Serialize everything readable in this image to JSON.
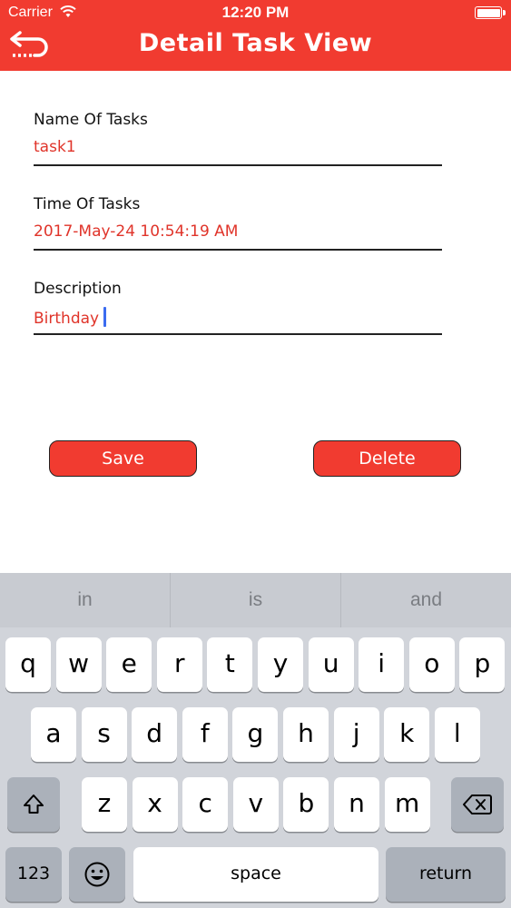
{
  "status_bar": {
    "carrier": "Carrier",
    "time": "12:20 PM"
  },
  "nav": {
    "title": "Detail Task View"
  },
  "fields": [
    {
      "label": "Name Of Tasks",
      "value": "task1"
    },
    {
      "label": "Time Of Tasks",
      "value": "2017-May-24 10:54:19 AM"
    },
    {
      "label": "Description",
      "value": "Birthday"
    }
  ],
  "buttons": {
    "save": "Save",
    "delete": "Delete"
  },
  "colors": {
    "accent": "#f13b30",
    "value_text": "#e0342a",
    "keyboard_bg": "#d1d4da"
  },
  "keyboard": {
    "suggestions": [
      "in",
      "is",
      "and"
    ],
    "row1": [
      "q",
      "w",
      "e",
      "r",
      "t",
      "y",
      "u",
      "i",
      "o",
      "p"
    ],
    "row2": [
      "a",
      "s",
      "d",
      "f",
      "g",
      "h",
      "j",
      "k",
      "l"
    ],
    "row3": [
      "z",
      "x",
      "c",
      "v",
      "b",
      "n",
      "m"
    ],
    "numbers": "123",
    "space": "space",
    "return": "return"
  }
}
